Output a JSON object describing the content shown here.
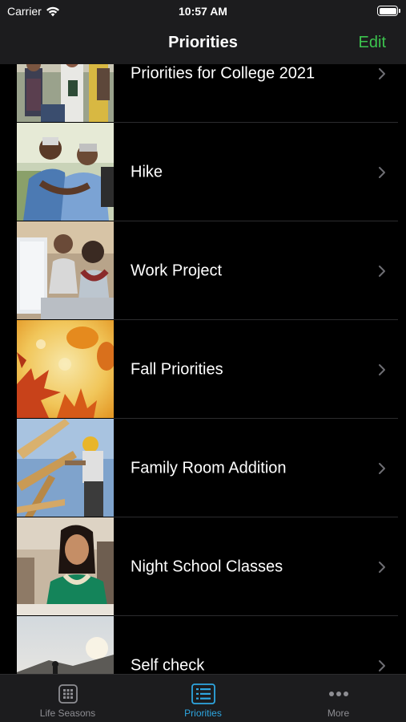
{
  "status_bar": {
    "carrier": "Carrier",
    "time": "10:57 AM"
  },
  "nav": {
    "title": "Priorities",
    "edit_label": "Edit",
    "edit_color": "#3cc44e"
  },
  "list": {
    "items": [
      {
        "label": "Priorities for College 2021",
        "image": "students-walking-photo"
      },
      {
        "label": "Hike",
        "image": "couple-hugging-photo"
      },
      {
        "label": "Work Project",
        "image": "coworkers-desk-photo"
      },
      {
        "label": "Fall Priorities",
        "image": "autumn-leaves-photo"
      },
      {
        "label": "Family Room Addition",
        "image": "construction-worker-photo"
      },
      {
        "label": "Night School Classes",
        "image": "student-classroom-photo"
      },
      {
        "label": "Self check",
        "image": "hiker-silhouette-photo"
      }
    ]
  },
  "tab_bar": {
    "active_color": "#2ea6e0",
    "tabs": [
      {
        "label": "Life Seasons",
        "icon": "grid-icon"
      },
      {
        "label": "Priorities",
        "icon": "list-icon",
        "active": true
      },
      {
        "label": "More",
        "icon": "more-icon"
      }
    ]
  }
}
